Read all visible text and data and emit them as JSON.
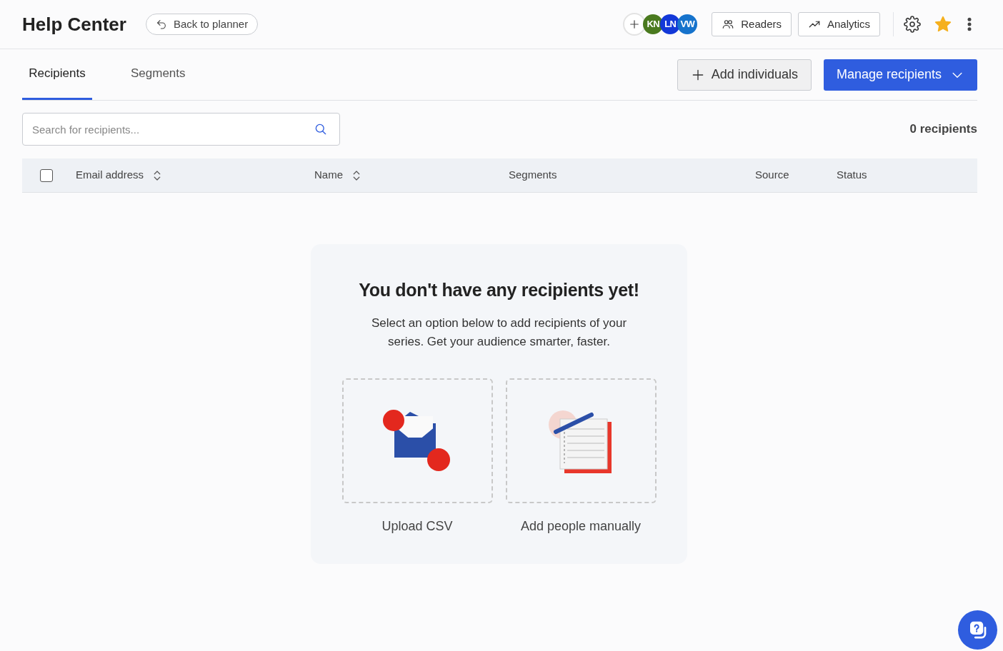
{
  "header": {
    "title": "Help Center",
    "back_button": "Back to planner",
    "avatars": [
      {
        "initials": "KN",
        "color": "#4a7a1f"
      },
      {
        "initials": "LN",
        "color": "#1338d8"
      },
      {
        "initials": "VW",
        "color": "#1673cc"
      }
    ],
    "buttons": [
      "Readers",
      "Analytics"
    ]
  },
  "tabs": [
    {
      "label": "Recipients",
      "selected": true
    },
    {
      "label": "Segments",
      "selected": false
    }
  ],
  "actions": {
    "add": "Add individuals",
    "manage": "Manage recipients"
  },
  "search": {
    "placeholder": "Search for recipients..."
  },
  "count": "0 recipients",
  "table": {
    "select_all_checked": false,
    "columns": [
      {
        "label": "Email address",
        "sortable": true
      },
      {
        "label": "Name",
        "sortable": true
      },
      {
        "label": "Segments",
        "sortable": false
      },
      {
        "label": "Source",
        "sortable": false
      },
      {
        "label": "Status",
        "sortable": false
      }
    ]
  },
  "empty_state": {
    "title": "You don't have any recipients yet!",
    "text": "Select an option below to add recipients of your series. Get your audience smarter, faster.",
    "options": [
      {
        "kind": "csv",
        "label": "Upload CSV"
      },
      {
        "kind": "manual",
        "label": "Add people manually"
      }
    ]
  }
}
